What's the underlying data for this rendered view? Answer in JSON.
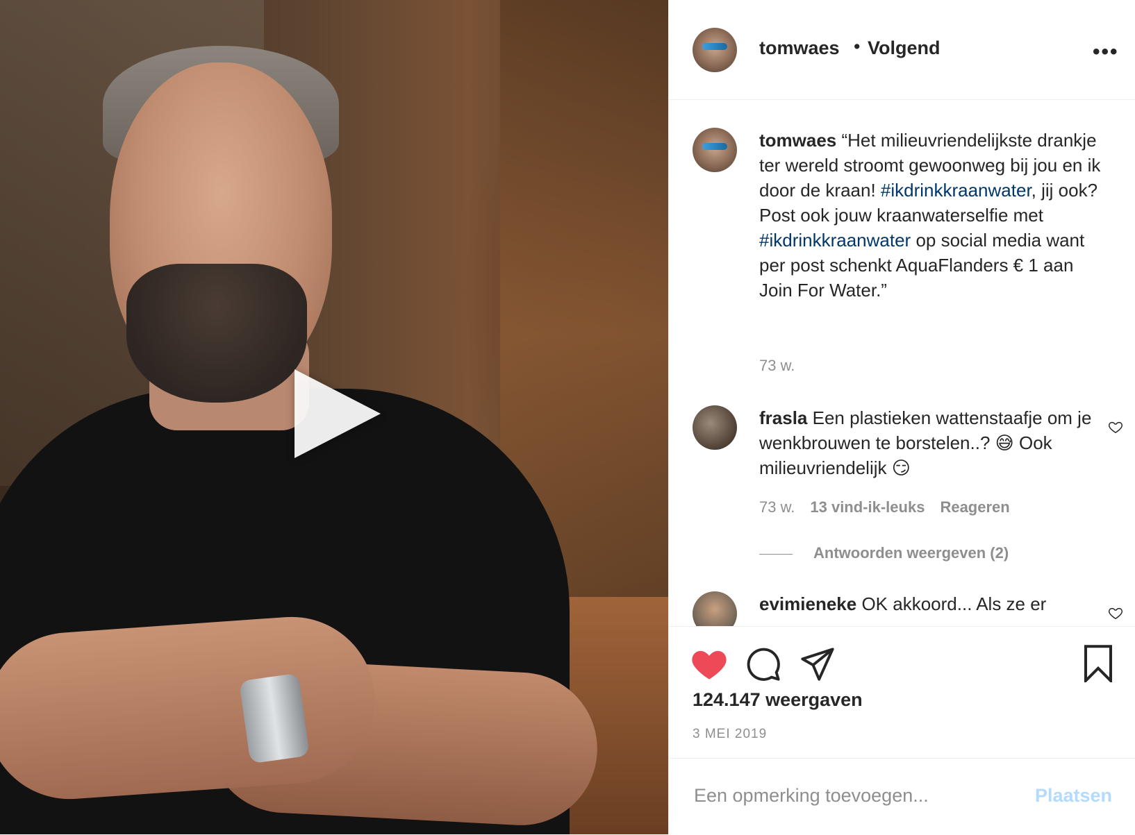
{
  "media": {
    "play_icon": "play-icon"
  },
  "header": {
    "username": "tomwaes",
    "separator": "•",
    "follow_status": "Volgend",
    "more_label": "•••"
  },
  "caption": {
    "username": "tomwaes",
    "text_1": "“Het milieuvriendelijkste drankje ter wereld stroomt gewoonweg bij jou en ik door de kraan! ",
    "hashtag_1": "#ikdrinkkraanwater",
    "text_2": ", jij ook? Post ook jouw kraanwaterselfie met ",
    "hashtag_2": "#ikdrinkkraanwater",
    "text_3": " op social media want per post schenkt AquaFlanders € 1 aan Join For Water.”",
    "age": "73 w."
  },
  "comments": [
    {
      "username": "frasla",
      "text": "Een plastieken wattenstaafje om je wenkbrouwen te borstelen..? 😅 Ook milieuvriendelijk 😏",
      "age": "73 w.",
      "likes": "13 vind-ik-leuks",
      "reply_label": "Reageren",
      "view_replies": "Antwoorden weergeven (2)"
    },
    {
      "username": "evimieneke",
      "text": "OK akkoord... Als ze er"
    }
  ],
  "actions": {
    "like_icon": "heart-filled-icon",
    "comment_icon": "comment-icon",
    "share_icon": "share-icon",
    "save_icon": "bookmark-icon",
    "like_color": "#ed4956"
  },
  "stats": {
    "views": "124.147 weergaven",
    "date": "3 MEI 2019"
  },
  "add_comment": {
    "placeholder": "Een opmerking toevoegen...",
    "post_label": "Plaatsen",
    "post_color": "#b3dbff"
  }
}
